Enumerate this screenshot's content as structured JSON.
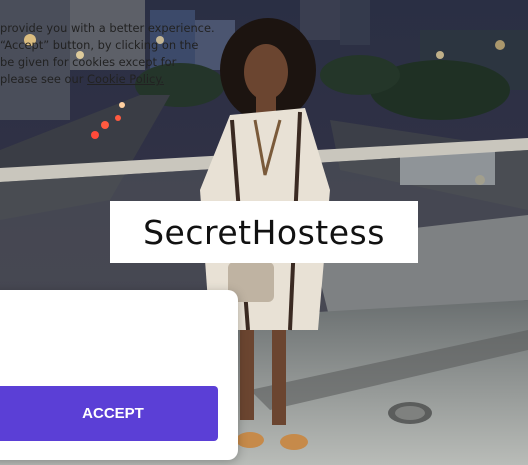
{
  "watermark": {
    "text": "SecretHostess"
  },
  "cookie_banner": {
    "line1": "provide you with a better experience.",
    "line2": "“Accept” button, by clicking on the",
    "line3": "be given for cookies except for",
    "line4_prefix": "please see our ",
    "policy_link": "Cookie Policy.",
    "accept_label": "ACCEPT"
  },
  "colors": {
    "accept_button": "#5b3fd6",
    "banner_background": "#ffffff",
    "watermark_background": "#ffffff"
  }
}
